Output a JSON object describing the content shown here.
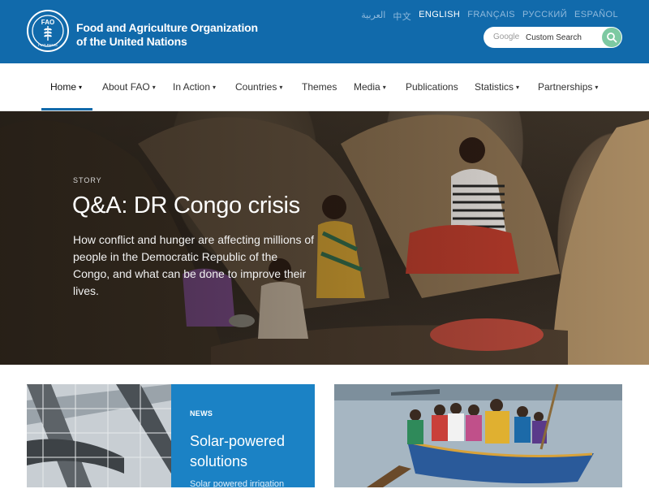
{
  "header": {
    "org_name_line1": "Food and Agriculture Organization",
    "org_name_line2": "of the United Nations",
    "logo_text": "FIAT PANIS",
    "logo_letters": "FAO",
    "languages": [
      "العربية",
      "中文",
      "ENGLISH",
      "FRANÇAIS",
      "РУССКИЙ",
      "ESPAÑOL"
    ],
    "active_language": "ENGLISH",
    "search": {
      "brand": "Google",
      "placeholder": "Custom Search"
    }
  },
  "nav": {
    "items": [
      {
        "label": "Home",
        "caret": "▾"
      },
      {
        "label": "About FAO",
        "caret": "▾"
      },
      {
        "label": "In Action",
        "caret": "▾"
      },
      {
        "label": "Countries",
        "caret": "▾"
      },
      {
        "label": "Themes",
        "caret": ""
      },
      {
        "label": "Media",
        "caret": "▾"
      },
      {
        "label": "Publications",
        "caret": ""
      },
      {
        "label": "Statistics",
        "caret": "▾"
      },
      {
        "label": "Partnerships",
        "caret": "▾"
      }
    ],
    "active": "Home"
  },
  "hero": {
    "kicker": "STORY",
    "title": "Q&A: DR Congo crisis",
    "description": "How conflict and hunger are affecting millions of people in the Democratic Republic of the Congo, and what can be done to improve their lives."
  },
  "cards": {
    "news": {
      "kicker": "NEWS",
      "title": "Solar-powered solutions",
      "snippet": "Solar powered irrigation"
    }
  },
  "colors": {
    "brand_blue": "#116aab",
    "card_blue": "#1b82c5",
    "search_button_green": "#7dc9a2"
  },
  "icons": {
    "search": "search-icon",
    "logo": "fao-logo-icon"
  }
}
